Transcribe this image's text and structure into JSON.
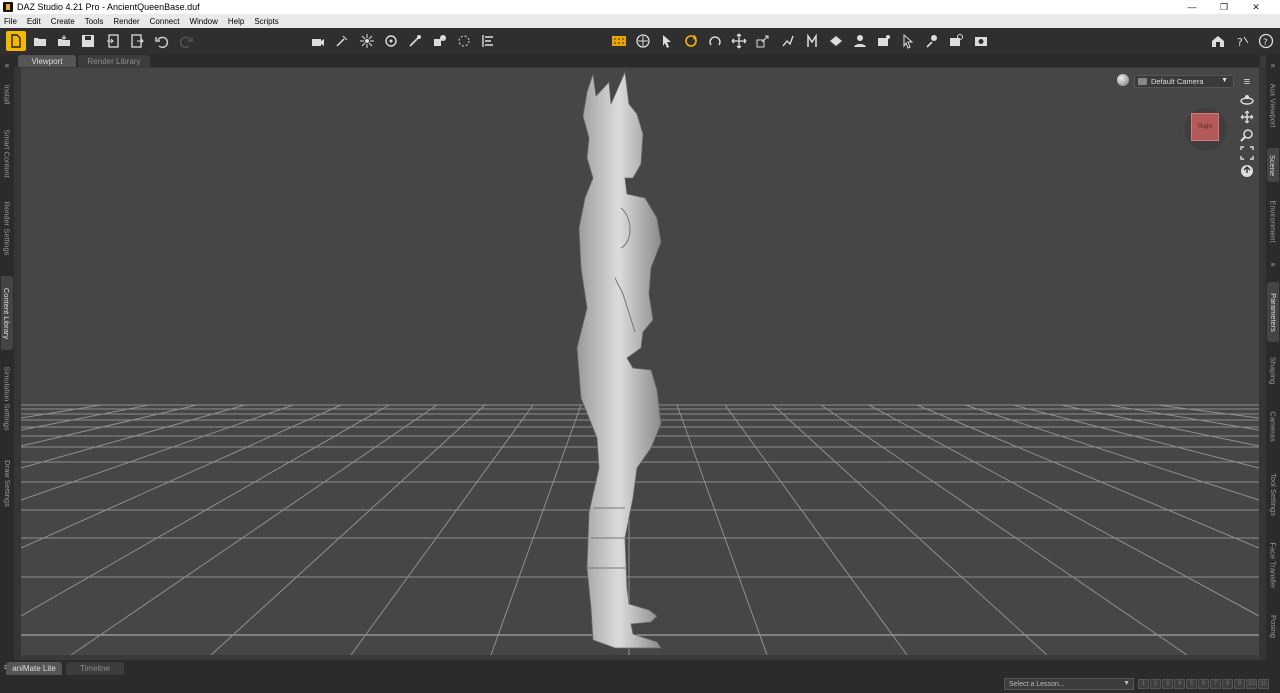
{
  "window": {
    "title": "DAZ Studio 4.21 Pro - AncientQueenBase.duf",
    "controls": [
      "—",
      "❐",
      "✕"
    ]
  },
  "menu": {
    "items": [
      "File",
      "Edit",
      "Create",
      "Tools",
      "Render",
      "Connect",
      "Window",
      "Help",
      "Scripts"
    ]
  },
  "toolbar": {
    "left_icons": [
      "new-file-icon",
      "open-folder-icon",
      "merge-folder-icon",
      "save-icon",
      "import-icon",
      "export-icon",
      "undo-icon",
      "redo-icon"
    ],
    "center_left_icons": [
      "create-camera-icon",
      "spotlight-icon",
      "point-light-icon",
      "distant-light-icon",
      "light-wand-icon",
      "primitive-icon",
      "null-icon",
      "align-icon"
    ],
    "center_icons": [
      "viewport-layout-icon",
      "universal-move-icon",
      "node-selection-icon",
      "rotate-icon",
      "twist-icon",
      "translate-icon",
      "scale-icon",
      "joint-editor-icon",
      "region-nav-icon",
      "power-pose-icon",
      "surface-selection-icon",
      "node-weight-icon",
      "spot-render-icon",
      "geometry-editor-icon",
      "transfer-icon",
      "render-settings-icon",
      "render-icon"
    ],
    "right_icons": [
      "home-icon",
      "whats-this-icon",
      "help-icon"
    ]
  },
  "tabs": {
    "viewport": "Viewport",
    "render_library": "Render Library"
  },
  "left_dock": [
    "Install",
    "Smart Content",
    "Render Settings",
    "Content Library",
    "Simulation Settings",
    "Draw Settings"
  ],
  "right_dock": [
    "Aux Viewport",
    "Scene",
    "Environment",
    "Parameters",
    "Shaping",
    "Cameras",
    "Tool Settings",
    "Face Transfer",
    "Posing"
  ],
  "viewport": {
    "camera": "Default Camera",
    "nav_cube_face": "Right"
  },
  "bottom_tabs": {
    "animate_lite": "aniMate Lite",
    "timeline": "Timeline"
  },
  "lesson": {
    "placeholder": "Select a Lesson...",
    "steps": [
      "1",
      "2",
      "3",
      "4",
      "5",
      "6",
      "7",
      "8",
      "9",
      "10",
      "11"
    ]
  }
}
